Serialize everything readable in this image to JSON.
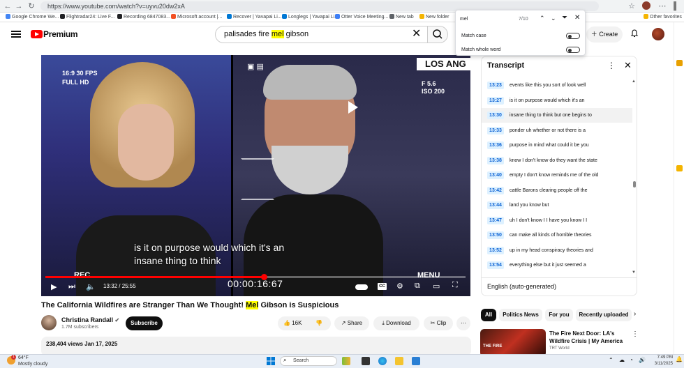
{
  "browser": {
    "url": "https://www.youtube.com/watch?v=uyvu20dw2xA",
    "bookmarks": [
      {
        "label": "Google Chrome We...",
        "color": "#4285f4"
      },
      {
        "label": "Flightradar24: Live F...",
        "color": "#f4b400"
      },
      {
        "label": "Recording 6847083...",
        "color": "#202124"
      },
      {
        "label": "Microsoft account |...",
        "color": "#f25022"
      },
      {
        "label": "Recover | Yavapai Li...",
        "color": "#0078d4"
      },
      {
        "label": "Longlegs | Yavapai Li...",
        "color": "#0078d4"
      },
      {
        "label": "Otter Voice Meeting...",
        "color": "#3d7ff6"
      },
      {
        "label": "New tab",
        "color": "#5f6368"
      },
      {
        "label": "New folder",
        "color": "#f4b400"
      },
      {
        "label": "Other favorites",
        "color": "#f4b400"
      }
    ]
  },
  "find_bar": {
    "query": "mel",
    "count": "7/10",
    "match_case_label": "Match case",
    "match_whole_word_label": "Match whole word"
  },
  "youtube": {
    "brand": "Premium",
    "search_prefix": "palisades fire ",
    "search_highlight": "mel",
    "search_suffix": " gibson",
    "create_label": "Create"
  },
  "player": {
    "overlay_top_left": [
      "16:9   30 FPS",
      "FULL HD"
    ],
    "overlay_top_right": [
      "F 5.6",
      "ISO 200"
    ],
    "network": "LOS ANG",
    "caption_line1": "is it on purpose would which it's an",
    "caption_line2": "insane thing to think",
    "rec_label": "REC",
    "menu_label": "MENU",
    "timer": "00:00:16:67",
    "time_display": "13:32 / 25:55",
    "progress": 0.52
  },
  "video": {
    "title_prefix": "The California Wildfires are Stranger Than We Thought! ",
    "title_highlight": "Mel",
    "title_suffix": " Gibson is Suspicious",
    "channel": "Christina Randall",
    "subscribers": "1.7M subscribers",
    "subscribe_label": "Subscribe",
    "likes": "16K",
    "share_label": "Share",
    "download_label": "Download",
    "clip_label": "Clip",
    "views_date": "238,404 views  Jan 17, 2025"
  },
  "transcript": {
    "title": "Transcript",
    "language": "English (auto-generated)",
    "rows": [
      {
        "time": "13:23",
        "text": "events like this you sort of look well"
      },
      {
        "time": "13:27",
        "text": "is it on purpose would which it's an"
      },
      {
        "time": "13:30",
        "text": "insane thing to think but one begins to"
      },
      {
        "time": "13:33",
        "text": "ponder uh whether or not there is a"
      },
      {
        "time": "13:36",
        "text": "purpose in mind what could it be you"
      },
      {
        "time": "13:38",
        "text": "know I don't know do they want the state"
      },
      {
        "time": "13:40",
        "text": "empty I don't know reminds me of the old"
      },
      {
        "time": "13:42",
        "text": "cattle Barons clearing people off the"
      },
      {
        "time": "13:44",
        "text": "land you know but"
      },
      {
        "time": "13:47",
        "text": "uh I don't know I I have you know I I"
      },
      {
        "time": "13:50",
        "text": "can make all kinds of horrible theories"
      },
      {
        "time": "13:52",
        "text": "up in my head conspiracy theories and"
      },
      {
        "time": "13:54",
        "text": "everything else but it just seemed a"
      }
    ],
    "active_index": 2
  },
  "chips": [
    "All",
    "Politics News",
    "For you",
    "Recently uploaded"
  ],
  "recommended": {
    "title": "The Fire Next Door: LA's Wildfire Crisis | My America",
    "channel": "TRT World",
    "thumb_text": "THE FIRE"
  },
  "taskbar": {
    "temp": "64°F",
    "weather": "Mostly cloudy",
    "search_placeholder": "Search",
    "time": "7:49 PM",
    "date": "3/11/2025"
  }
}
